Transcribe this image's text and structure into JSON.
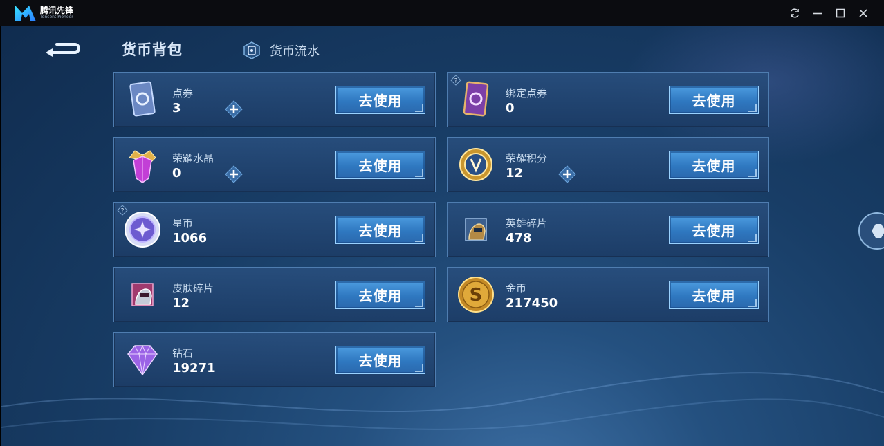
{
  "window": {
    "app_name": "腾讯先锋",
    "app_subtitle": "Tencent Pioneer",
    "controls": [
      "refresh-icon",
      "minimize-icon",
      "maximize-icon",
      "close-icon"
    ]
  },
  "header": {
    "title": "货币背包",
    "tab_flow_label": "货币流水"
  },
  "use_button_label": "去使用",
  "currencies": [
    {
      "name": "点券",
      "value": "3",
      "icon": "coupon-card-icon",
      "has_plus": true,
      "has_help": false
    },
    {
      "name": "绑定点券",
      "value": "0",
      "icon": "bound-coupon-card-icon",
      "has_plus": false,
      "has_help": true
    },
    {
      "name": "荣耀水晶",
      "value": "0",
      "icon": "glory-crystal-icon",
      "has_plus": true,
      "has_help": false
    },
    {
      "name": "荣耀积分",
      "value": "12",
      "icon": "glory-points-icon",
      "has_plus": true,
      "has_help": false
    },
    {
      "name": "星币",
      "value": "1066",
      "icon": "star-coin-icon",
      "has_plus": false,
      "has_help": true
    },
    {
      "name": "英雄碎片",
      "value": "478",
      "icon": "hero-fragment-icon",
      "has_plus": false,
      "has_help": false
    },
    {
      "name": "皮肤碎片",
      "value": "12",
      "icon": "skin-fragment-icon",
      "has_plus": false,
      "has_help": false
    },
    {
      "name": "金币",
      "value": "217450",
      "icon": "gold-coin-icon",
      "has_plus": false,
      "has_help": false
    },
    {
      "name": "钻石",
      "value": "19271",
      "icon": "diamond-icon",
      "has_plus": false,
      "has_help": false
    }
  ],
  "colors": {
    "background": "#183d66",
    "card": "#264e7d",
    "card_border": "#4f7db0",
    "button": "#3a86cc",
    "button_border": "#9ad2ff"
  }
}
